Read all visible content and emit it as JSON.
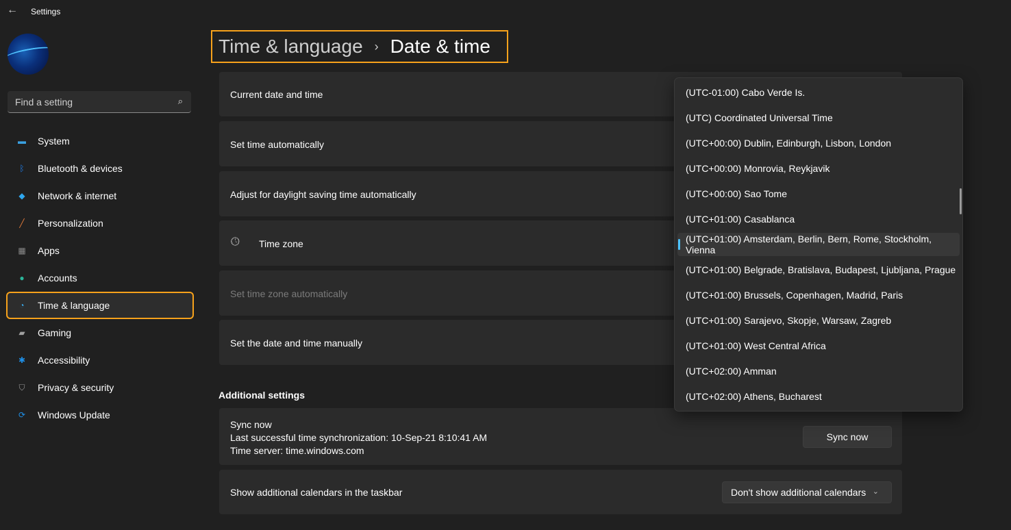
{
  "window": {
    "title": "Settings",
    "back": "←"
  },
  "sidebar": {
    "search_placeholder": "Find a setting",
    "items": [
      {
        "label": "System",
        "icon": "monitor-icon",
        "color": "#3aa0e0"
      },
      {
        "label": "Bluetooth & devices",
        "icon": "bluetooth-icon",
        "color": "#1f7de6"
      },
      {
        "label": "Network & internet",
        "icon": "wifi-icon",
        "color": "#2fa7ef"
      },
      {
        "label": "Personalization",
        "icon": "brush-icon",
        "color": "#e07a3a"
      },
      {
        "label": "Apps",
        "icon": "apps-icon",
        "color": "#8a8a8a"
      },
      {
        "label": "Accounts",
        "icon": "person-icon",
        "color": "#2bb69a"
      },
      {
        "label": "Time & language",
        "icon": "clock-globe-icon",
        "color": "#3aa8e8",
        "selected": true
      },
      {
        "label": "Gaming",
        "icon": "gamepad-icon",
        "color": "#a0a0a0"
      },
      {
        "label": "Accessibility",
        "icon": "accessibility-icon",
        "color": "#1f8fe6"
      },
      {
        "label": "Privacy & security",
        "icon": "shield-icon",
        "color": "#9a9a9a"
      },
      {
        "label": "Windows Update",
        "icon": "update-icon",
        "color": "#1f8fe6"
      }
    ]
  },
  "breadcrumb": {
    "parent": "Time & language",
    "separator": "›",
    "current": "Date & time"
  },
  "rows": {
    "current": "Current date and time",
    "auto_time": "Set time automatically",
    "dst": "Adjust for daylight saving time automatically",
    "timezone": "Time zone",
    "auto_tz": "Set time zone automatically",
    "manual": "Set the date and time manually"
  },
  "additional": {
    "heading": "Additional settings",
    "sync_title": "Sync now",
    "sync_last": "Last successful time synchronization: 10-Sep-21 8:10:41 AM",
    "sync_server": "Time server: time.windows.com",
    "sync_button": "Sync now",
    "calendars_label": "Show additional calendars in the taskbar",
    "calendars_value": "Don't show additional calendars"
  },
  "timezone_dropdown": {
    "selected_index": 6,
    "accent": "#4cc2ff",
    "options": [
      "(UTC-01:00) Cabo Verde Is.",
      "(UTC) Coordinated Universal Time",
      "(UTC+00:00) Dublin, Edinburgh, Lisbon, London",
      "(UTC+00:00) Monrovia, Reykjavik",
      "(UTC+00:00) Sao Tome",
      "(UTC+01:00) Casablanca",
      "(UTC+01:00) Amsterdam, Berlin, Bern, Rome, Stockholm, Vienna",
      "(UTC+01:00) Belgrade, Bratislava, Budapest, Ljubljana, Prague",
      "(UTC+01:00) Brussels, Copenhagen, Madrid, Paris",
      "(UTC+01:00) Sarajevo, Skopje, Warsaw, Zagreb",
      "(UTC+01:00) West Central Africa",
      "(UTC+02:00) Amman",
      "(UTC+02:00) Athens, Bucharest"
    ]
  }
}
